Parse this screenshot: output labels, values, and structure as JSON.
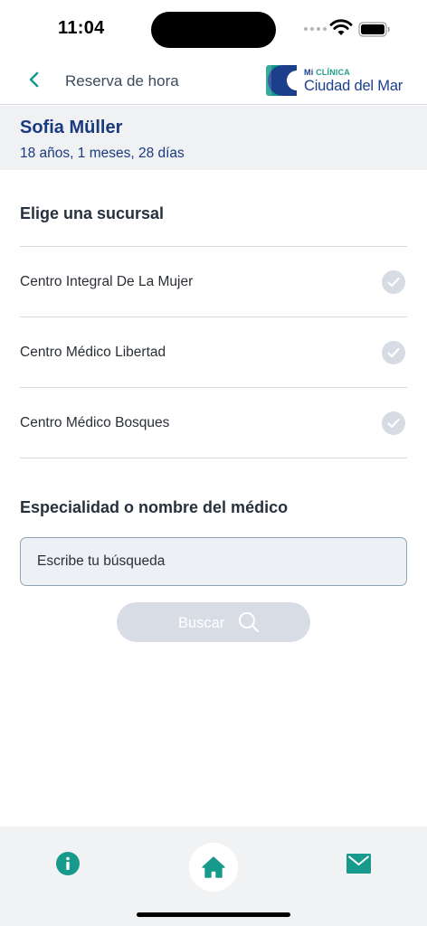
{
  "status_bar": {
    "time": "11:04"
  },
  "header": {
    "back_icon": "chevron-left-icon",
    "title": "Reserva de hora",
    "logo": {
      "prefix": "Mi",
      "small": "CLÍNICA",
      "main": "Ciudad del Mar"
    }
  },
  "patient": {
    "name": "Sofia Müller",
    "age": "18 años, 1 meses, 28 días"
  },
  "branches": {
    "title": "Elige una sucursal",
    "items": [
      {
        "label": "Centro Integral De La Mujer",
        "icon": "check-circle-icon"
      },
      {
        "label": "Centro Médico Libertad",
        "icon": "check-circle-icon"
      },
      {
        "label": "Centro Médico Bosques",
        "icon": "check-circle-icon"
      }
    ]
  },
  "search": {
    "title": "Especialidad o nombre del médico",
    "placeholder": "Escribe tu búsqueda",
    "button_label": "Buscar",
    "button_icon": "search-icon"
  },
  "tab_bar": {
    "items": [
      {
        "icon": "info-icon"
      },
      {
        "icon": "home-icon"
      },
      {
        "icon": "mail-icon"
      }
    ]
  },
  "colors": {
    "accent": "#17998c",
    "brand_blue": "#1a3a7f",
    "disabled_button": "#d7dce5"
  }
}
